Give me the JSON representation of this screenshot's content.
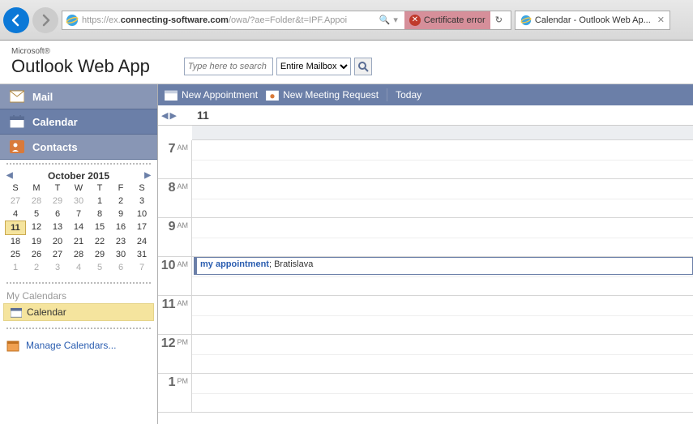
{
  "browser": {
    "url_prefix": "https://ex.",
    "url_domain": "connecting-software.com",
    "url_suffix": "/owa/?ae=Folder&t=IPF.Appoi",
    "cert_error": "Certificate error",
    "tab_title": "Calendar - Outlook Web Ap..."
  },
  "header": {
    "ms": "Microsoft®",
    "app": "Outlook Web App",
    "search_placeholder": "Type here to search",
    "scope": "Entire Mailbox"
  },
  "nav": {
    "mail": "Mail",
    "calendar": "Calendar",
    "contacts": "Contacts"
  },
  "minical": {
    "title": "October 2015",
    "dow": [
      "S",
      "M",
      "T",
      "W",
      "T",
      "F",
      "S"
    ],
    "weeks": [
      [
        {
          "d": "27",
          "g": true
        },
        {
          "d": "28",
          "g": true
        },
        {
          "d": "29",
          "g": true
        },
        {
          "d": "30",
          "g": true
        },
        {
          "d": "1"
        },
        {
          "d": "2"
        },
        {
          "d": "3"
        }
      ],
      [
        {
          "d": "4"
        },
        {
          "d": "5"
        },
        {
          "d": "6"
        },
        {
          "d": "7"
        },
        {
          "d": "8"
        },
        {
          "d": "9"
        },
        {
          "d": "10"
        }
      ],
      [
        {
          "d": "11",
          "t": true
        },
        {
          "d": "12"
        },
        {
          "d": "13"
        },
        {
          "d": "14"
        },
        {
          "d": "15"
        },
        {
          "d": "16"
        },
        {
          "d": "17"
        }
      ],
      [
        {
          "d": "18"
        },
        {
          "d": "19"
        },
        {
          "d": "20"
        },
        {
          "d": "21"
        },
        {
          "d": "22"
        },
        {
          "d": "23"
        },
        {
          "d": "24"
        }
      ],
      [
        {
          "d": "25"
        },
        {
          "d": "26"
        },
        {
          "d": "27"
        },
        {
          "d": "28"
        },
        {
          "d": "29"
        },
        {
          "d": "30"
        },
        {
          "d": "31"
        }
      ],
      [
        {
          "d": "1",
          "g": true
        },
        {
          "d": "2",
          "g": true
        },
        {
          "d": "3",
          "g": true
        },
        {
          "d": "4",
          "g": true
        },
        {
          "d": "5",
          "g": true
        },
        {
          "d": "6",
          "g": true
        },
        {
          "d": "7",
          "g": true
        }
      ]
    ]
  },
  "mycal": {
    "label": "My Calendars",
    "item": "Calendar",
    "manage": "Manage Calendars..."
  },
  "toolbar": {
    "new_appt": "New Appointment",
    "new_meeting": "New Meeting Request",
    "today": "Today"
  },
  "day": {
    "num": "11",
    "hours": [
      {
        "h": "7",
        "ap": "AM"
      },
      {
        "h": "8",
        "ap": "AM"
      },
      {
        "h": "9",
        "ap": "AM"
      },
      {
        "h": "10",
        "ap": "AM"
      },
      {
        "h": "11",
        "ap": "AM"
      },
      {
        "h": "12",
        "ap": "PM"
      },
      {
        "h": "1",
        "ap": "PM"
      }
    ]
  },
  "appt": {
    "title": "my appointment",
    "loc": "; Bratislava",
    "hour_index": 3
  }
}
